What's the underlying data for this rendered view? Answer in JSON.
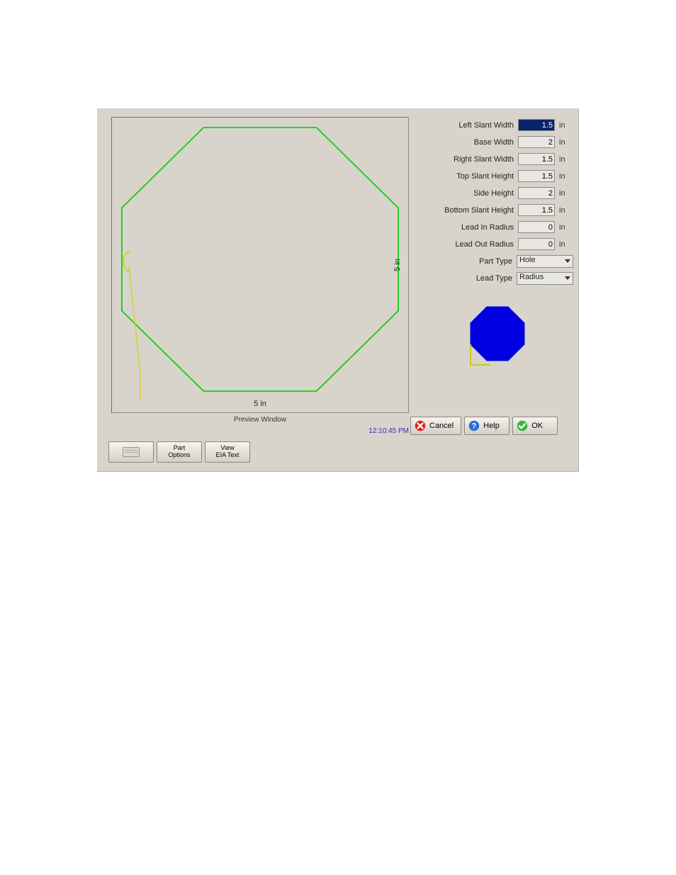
{
  "preview": {
    "caption": "Preview Window",
    "width_label": "5 in",
    "height_label": "5 in"
  },
  "params": {
    "left_slant_width": {
      "label": "Left Slant Width",
      "value": "1.5",
      "unit": "in",
      "selected": true
    },
    "base_width": {
      "label": "Base Width",
      "value": "2",
      "unit": "in"
    },
    "right_slant_width": {
      "label": "Right Slant Width",
      "value": "1.5",
      "unit": "in"
    },
    "top_slant_height": {
      "label": "Top Slant Height",
      "value": "1.5",
      "unit": "in"
    },
    "side_height": {
      "label": "Side Height",
      "value": "2",
      "unit": "in"
    },
    "bottom_slant_height": {
      "label": "Bottom Slant Height",
      "value": "1.5",
      "unit": "in"
    },
    "lead_in_radius": {
      "label": "Lead In Radius",
      "value": "0",
      "unit": "in"
    },
    "lead_out_radius": {
      "label": "Lead Out Radius",
      "value": "0",
      "unit": "in"
    },
    "part_type": {
      "label": "Part Type",
      "value": "Hole"
    },
    "lead_type": {
      "label": "Lead Type",
      "value": "Radius"
    }
  },
  "footer": {
    "cancel": "Cancel",
    "help": "Help",
    "ok": "OK",
    "timestamp": "12:10:45 PM"
  },
  "toolbar": {
    "keyboard": "",
    "part_options_line1": "Part",
    "part_options_line2": "Options",
    "view_eia_line1": "View",
    "view_eia_line2": "EIA Text"
  }
}
